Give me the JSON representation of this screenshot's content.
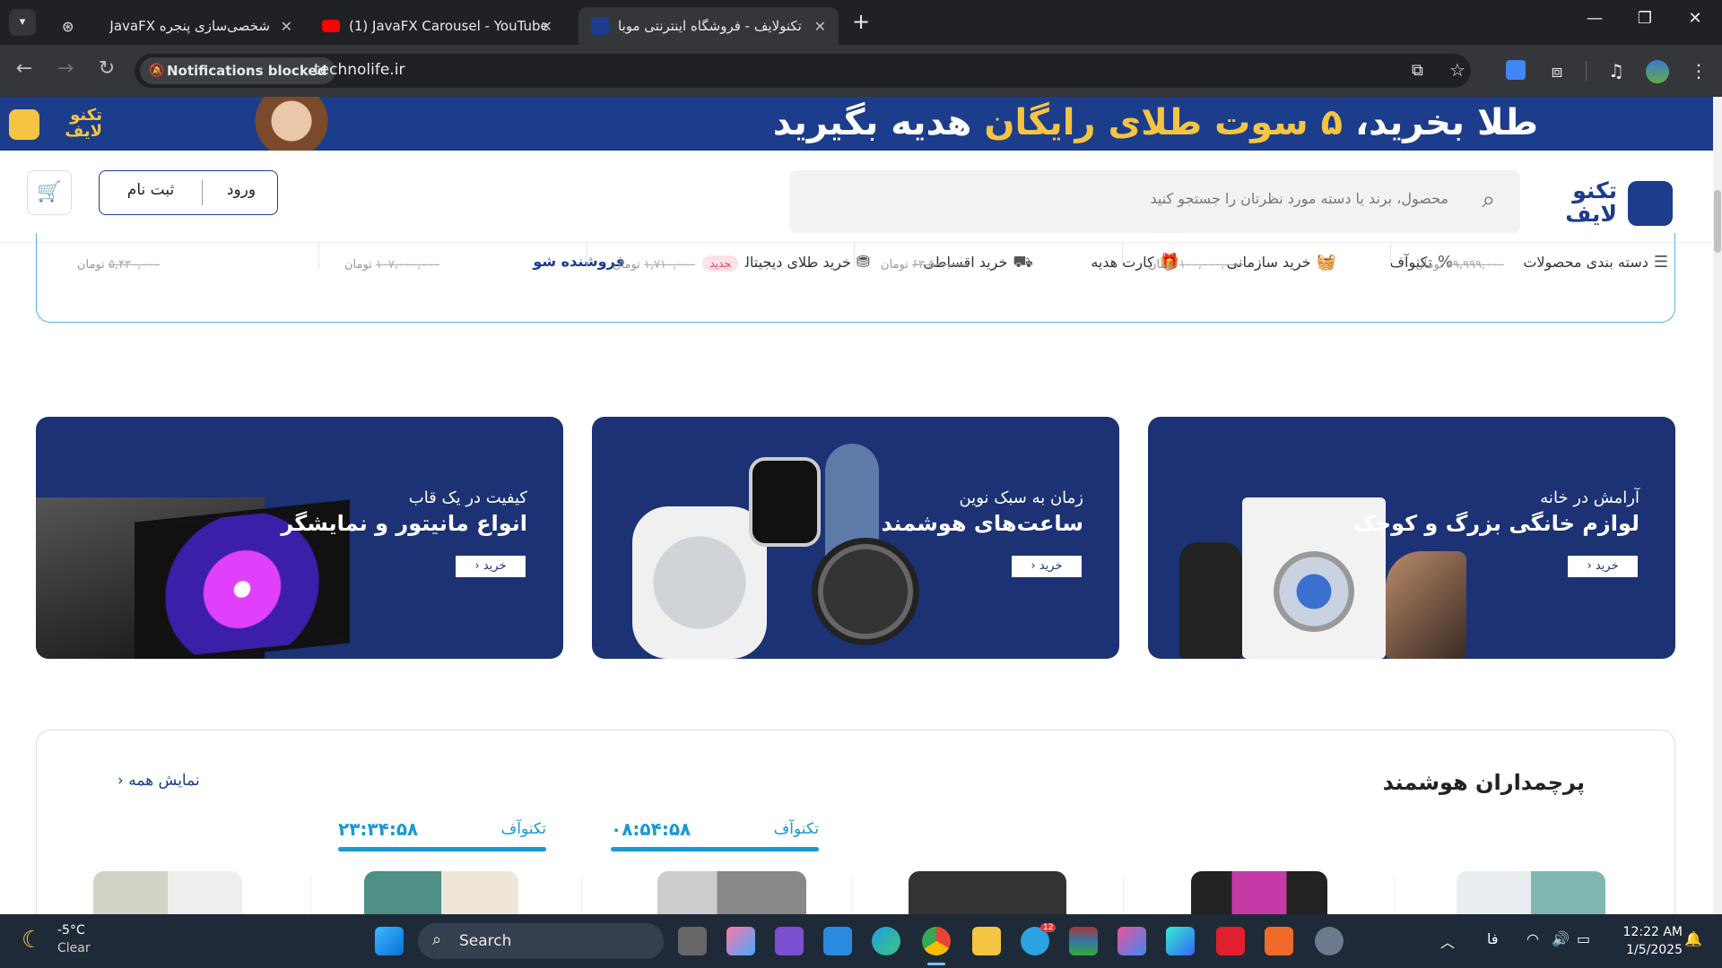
{
  "browser": {
    "tabs": [
      {
        "title": "شخصی‌سازی پنجره JavaFX",
        "favicon": "openai-icon"
      },
      {
        "title": "(1) JavaFX Carousel - YouTube",
        "favicon": "youtube-icon"
      },
      {
        "title": "تکنولایف - فروشگاه اینترنتی موبا",
        "favicon": "technolife-icon",
        "active": true
      }
    ],
    "notification": "Notifications blocked",
    "url": "technolife.ir"
  },
  "promo": {
    "text_plain_start": "طلا بخرید، ",
    "text_gold": "۵ سوت طلای رایگان",
    "text_plain_end": " هدیه بگیرید",
    "logo": "تکنو لایف"
  },
  "header": {
    "logo": "تکنو لایف",
    "search_placeholder": "محصول، برند یا دسته مورد نظرتان را جستجو کنید",
    "login": "ورود",
    "register": "ثبت نام"
  },
  "nav": {
    "items": [
      {
        "label": "دسته بندی محصولات",
        "icon": "menu-icon"
      },
      {
        "label": "تکنوآف",
        "icon": "percent-icon"
      },
      {
        "label": "خرید سازمانی",
        "icon": "basket-icon"
      },
      {
        "label": "کارت هدیه",
        "icon": "gift-icon"
      },
      {
        "label": "خرید اقساطی",
        "icon": "installment-icon"
      },
      {
        "label": "خرید طلای دیجیتال",
        "icon": "coins-icon",
        "badge": "جدید"
      },
      {
        "label": "فروشنده شو",
        "icon": ""
      }
    ]
  },
  "strip_prices": [
    {
      "old": "۶۹,۹۹۹,۰۰۰",
      "unit": "تومان"
    },
    {
      "old": "۱۰۰,۰۰۰,۰۰۰",
      "unit": "تومان"
    },
    {
      "old": "۶۳,۵۰۰,۰۰۰",
      "unit": "تومان"
    },
    {
      "old": "۱,۷۱۰,۰۰۰",
      "unit": "تومان"
    },
    {
      "old": "۱۰۷,۰۰۰,۰۰۰",
      "unit": "تومان"
    },
    {
      "old": "۵,۴۳۰,۰۰۰",
      "unit": "تومان"
    }
  ],
  "banners": [
    {
      "sub": "آرامش در خانه",
      "main": "لوازم خانگی بزرگ و کوچک",
      "cta": "خرید ‹"
    },
    {
      "sub": "زمان به سبک نوین",
      "main": "ساعت‌های هوشمند",
      "cta": "خرید ‹"
    },
    {
      "sub": "کیفیت در یک قاب",
      "main": "انواع مانیتور و نمایشگر",
      "cta": "خرید ‹"
    }
  ],
  "flagship": {
    "title": "پرچمداران هوشمند",
    "show_all": "نمایش همه",
    "timers": [
      {
        "label": "تکنوآف",
        "time": "۰۸:۵۴:۵۸"
      },
      {
        "label": "تکنوآف",
        "time": "۲۳:۳۴:۵۸"
      }
    ]
  },
  "taskbar": {
    "weather_temp": "-5°C",
    "weather_desc": "Clear",
    "search": "Search",
    "lang": "فا",
    "time": "12:22 AM",
    "date": "1/5/2025",
    "telegram_badge": "12"
  },
  "colors": {
    "brand": "#1c3c8c",
    "accent": "#1c98d1",
    "gold": "#f5c542"
  }
}
